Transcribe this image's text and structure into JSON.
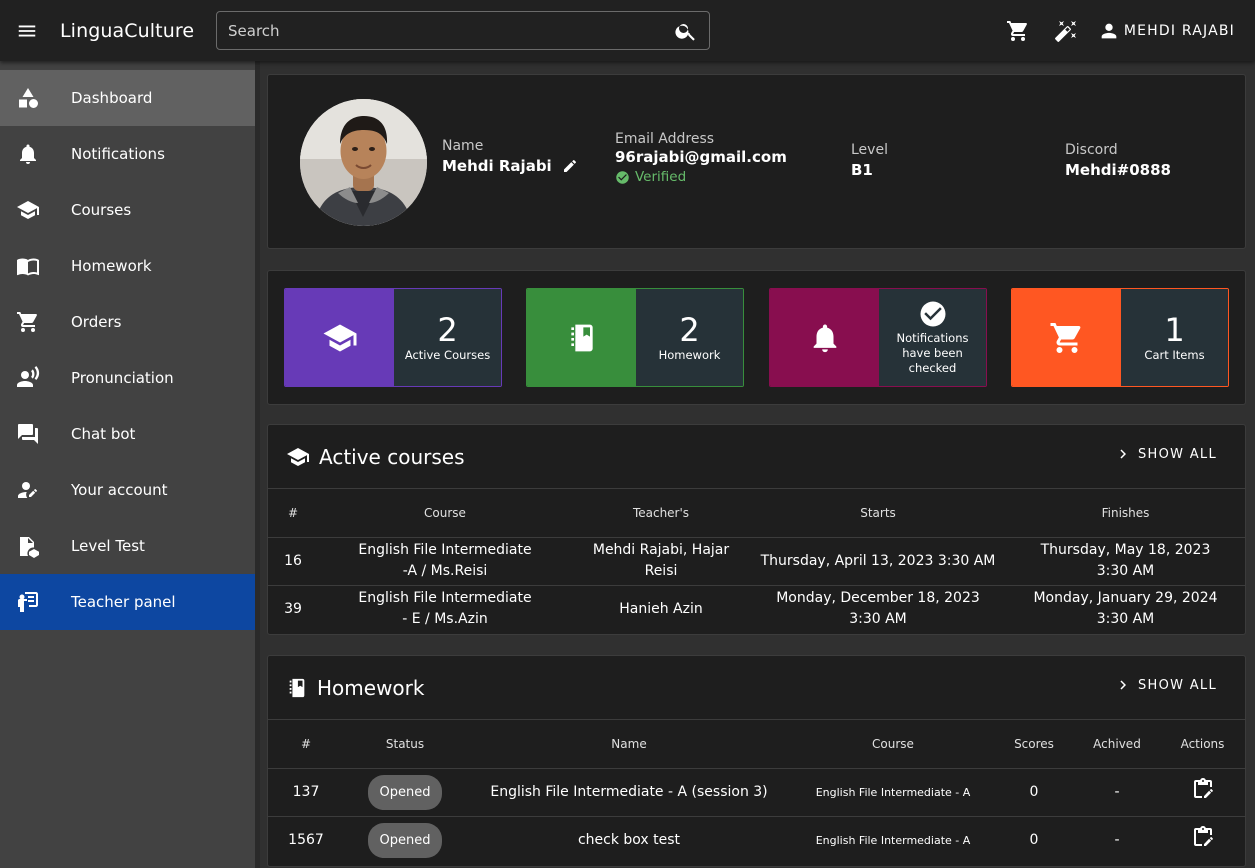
{
  "header": {
    "app_title": "LinguaCulture",
    "search_placeholder": "Search",
    "user_label": "MEHDI RAJABI"
  },
  "sidebar": {
    "items": [
      {
        "label": "Dashboard",
        "icon": "category-icon"
      },
      {
        "label": "Notifications",
        "icon": "bell-icon"
      },
      {
        "label": "Courses",
        "icon": "school-icon"
      },
      {
        "label": "Homework",
        "icon": "menu-book-icon"
      },
      {
        "label": "Orders",
        "icon": "cart-icon"
      },
      {
        "label": "Pronunciation",
        "icon": "voice-icon"
      },
      {
        "label": "Chat bot",
        "icon": "chat-icon"
      },
      {
        "label": "Your account",
        "icon": "person-edit-icon"
      },
      {
        "label": "Level Test",
        "icon": "quiz-icon"
      },
      {
        "label": "Teacher panel",
        "icon": "teacher-icon"
      }
    ]
  },
  "profile": {
    "name_label": "Name",
    "name": "Mehdi Rajabi",
    "email_label": "Email Address",
    "email": "96rajabi@gmail.com",
    "verified": "Verified",
    "level_label": "Level",
    "level": "B1",
    "discord_label": "Discord",
    "discord": "Mehdi#0888"
  },
  "stats": [
    {
      "num": "2",
      "caption": "Active Courses",
      "color": "#673ab7"
    },
    {
      "num": "2",
      "caption": "Homework",
      "color": "#388e3c"
    },
    {
      "num": "",
      "caption": "Notifications have been checked",
      "color": "#880e4f"
    },
    {
      "num": "1",
      "caption": "Cart Items",
      "color": "#ff5722"
    }
  ],
  "active_courses": {
    "title": "Active courses",
    "show_all": "SHOW ALL",
    "columns": [
      "#",
      "Course",
      "Teacher's",
      "Starts",
      "Finishes"
    ],
    "rows": [
      {
        "id": "16",
        "course": "English File Intermediate -A / Ms.Reisi",
        "teacher": "Mehdi Rajabi, Hajar Reisi",
        "starts": "Thursday, April 13, 2023 3:30 AM",
        "finishes": "Thursday, May 18, 2023 3:30 AM"
      },
      {
        "id": "39",
        "course": "English File Intermediate - E / Ms.Azin",
        "teacher": "Hanieh Azin",
        "starts": "Monday, December 18, 2023 3:30 AM",
        "finishes": "Monday, January 29, 2024 3:30 AM"
      }
    ]
  },
  "homework": {
    "title": "Homework",
    "show_all": "SHOW ALL",
    "columns": [
      "#",
      "Status",
      "Name",
      "Course",
      "Scores",
      "Achived",
      "Actions"
    ],
    "rows": [
      {
        "id": "137",
        "status": "Opened",
        "name": "English File Intermediate - A (session 3)",
        "course": "English File Intermediate - A",
        "score": "0",
        "achived": "-"
      },
      {
        "id": "1567",
        "status": "Opened",
        "name": "check box test",
        "course": "English File Intermediate - A",
        "score": "0",
        "achived": "-"
      }
    ]
  }
}
